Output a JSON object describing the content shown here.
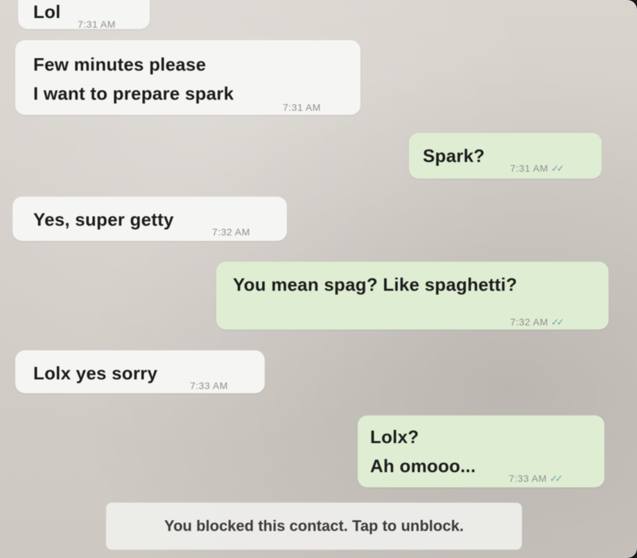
{
  "messages": [
    {
      "id": "m1",
      "direction": "incoming",
      "lines": [
        "Lol"
      ],
      "time": "7:31 AM"
    },
    {
      "id": "m2",
      "direction": "incoming",
      "lines": [
        "Few minutes please",
        "I want to prepare spark"
      ],
      "time": "7:31 AM"
    },
    {
      "id": "m3",
      "direction": "outgoing",
      "lines": [
        "Spark?"
      ],
      "time": "7:31 AM",
      "ticks": "✓✓"
    },
    {
      "id": "m4",
      "direction": "incoming",
      "lines": [
        "Yes, super getty"
      ],
      "time": "7:32 AM"
    },
    {
      "id": "m5",
      "direction": "outgoing",
      "lines": [
        "You mean spag? Like spaghetti?"
      ],
      "time": "7:32 AM",
      "ticks": "✓✓"
    },
    {
      "id": "m6",
      "direction": "incoming",
      "lines": [
        "Lolx yes sorry"
      ],
      "time": "7:33 AM"
    },
    {
      "id": "m7",
      "direction": "outgoing",
      "lines": [
        "Lolx?",
        "Ah omooo..."
      ],
      "time": "7:33 AM",
      "ticks": "✓✓"
    }
  ],
  "blocked_notice": "You blocked this contact. Tap to unblock.",
  "colors": {
    "wallpaper": "#d3cec8",
    "incoming_bubble": "#f5f5f4",
    "outgoing_bubble": "#dfeed3",
    "text": "#1c1c1c",
    "timestamp": "#8e8e8e",
    "read_ticks": "#7aa0b8"
  }
}
